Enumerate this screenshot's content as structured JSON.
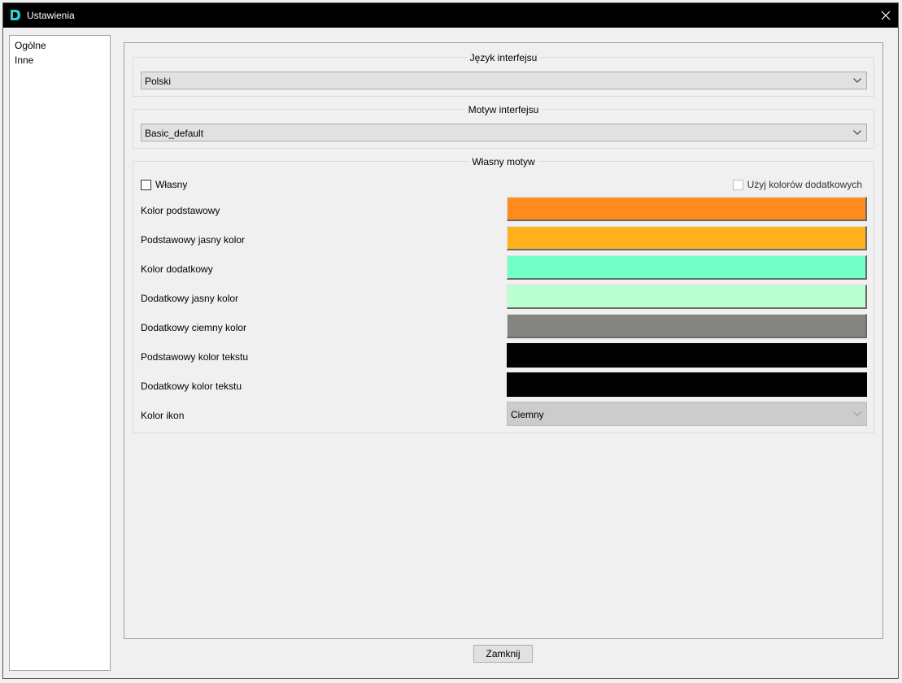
{
  "window": {
    "title": "Ustawienia"
  },
  "sidebar": {
    "items": [
      {
        "label": "Ogólne"
      },
      {
        "label": "Inne"
      }
    ]
  },
  "language": {
    "group_title": "Język interfejsu",
    "selected": "Polski"
  },
  "theme": {
    "group_title": "Motyw interfejsu",
    "selected": "Basic_default"
  },
  "custom_theme": {
    "group_title": "Własny motyw",
    "custom_checkbox": {
      "label": "Własny",
      "checked": false
    },
    "additional_colors_checkbox": {
      "label": "Użyj kolorów dodatkowych",
      "checked": false,
      "enabled": false
    },
    "colors": [
      {
        "label": "Kolor podstawowy",
        "color": "#ff8a1e"
      },
      {
        "label": "Podstawowy jasny kolor",
        "color": "#ffb21e"
      },
      {
        "label": "Kolor dodatkowy",
        "color": "#73ffc8"
      },
      {
        "label": "Dodatkowy jasny kolor",
        "color": "#b9ffd0"
      },
      {
        "label": "Dodatkowy ciemny kolor",
        "color": "#848480"
      },
      {
        "label": "Podstawowy kolor tekstu",
        "color": "#000000"
      },
      {
        "label": "Dodatkowy kolor tekstu",
        "color": "#000000"
      }
    ],
    "icon_color": {
      "label": "Kolor ikon",
      "selected": "Ciemny"
    }
  },
  "footer": {
    "close_label": "Zamknij"
  },
  "accent_color": "#27d3d9"
}
